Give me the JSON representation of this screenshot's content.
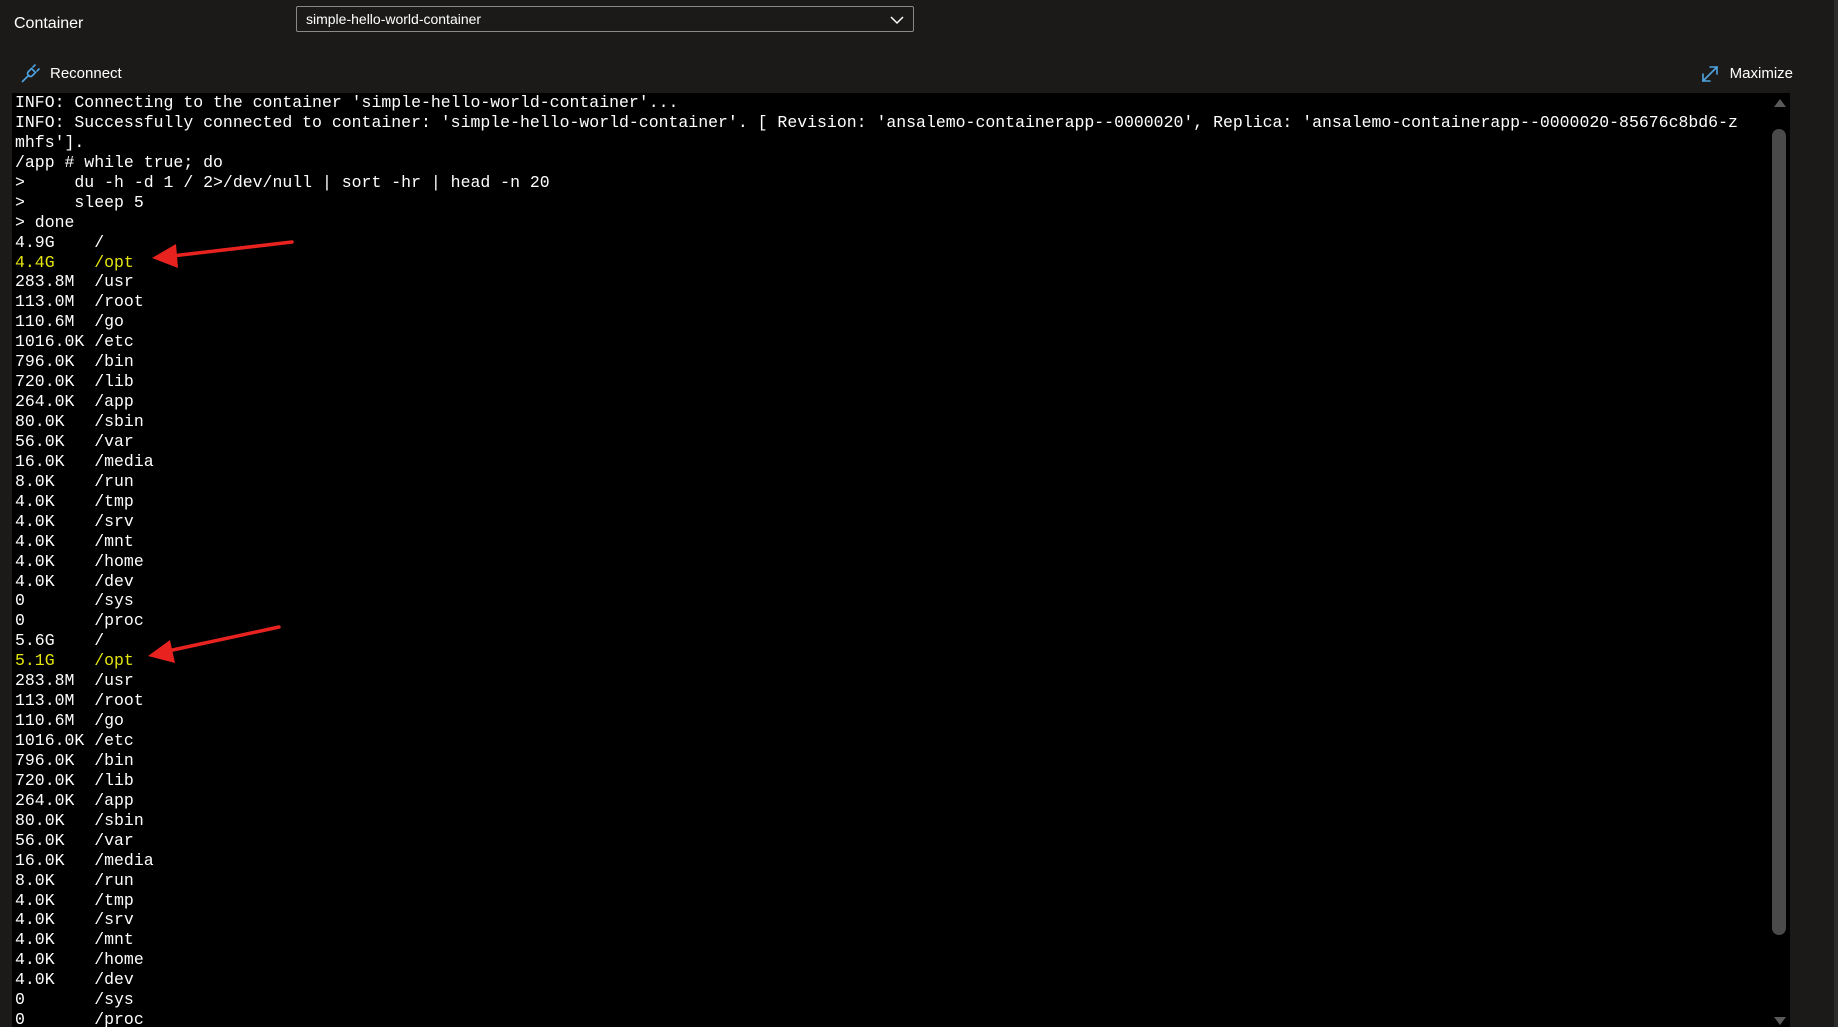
{
  "header": {
    "container_label": "Container",
    "container_select_value": "simple-hello-world-container"
  },
  "toolbar": {
    "reconnect_label": "Reconnect",
    "maximize_label": "Maximize"
  },
  "terminal": {
    "highlight_color": "#e5e510",
    "lines": [
      {
        "text": "INFO: Connecting to the container 'simple-hello-world-container'..."
      },
      {
        "text": "INFO: Successfully connected to container: 'simple-hello-world-container'. [ Revision: 'ansalemo-containerapp--0000020', Replica: 'ansalemo-containerapp--0000020-85676c8bd6-z"
      },
      {
        "text": "mhfs']."
      },
      {
        "text": "/app # while true; do"
      },
      {
        "text": ">     du -h -d 1 / 2>/dev/null | sort -hr | head -n 20"
      },
      {
        "text": ">     sleep 5"
      },
      {
        "text": "> done"
      },
      {
        "text": "4.9G    /"
      },
      {
        "text": "4.4G    /opt",
        "highlight": true
      },
      {
        "text": "283.8M  /usr"
      },
      {
        "text": "113.0M  /root"
      },
      {
        "text": "110.6M  /go"
      },
      {
        "text": "1016.0K /etc"
      },
      {
        "text": "796.0K  /bin"
      },
      {
        "text": "720.0K  /lib"
      },
      {
        "text": "264.0K  /app"
      },
      {
        "text": "80.0K   /sbin"
      },
      {
        "text": "56.0K   /var"
      },
      {
        "text": "16.0K   /media"
      },
      {
        "text": "8.0K    /run"
      },
      {
        "text": "4.0K    /tmp"
      },
      {
        "text": "4.0K    /srv"
      },
      {
        "text": "4.0K    /mnt"
      },
      {
        "text": "4.0K    /home"
      },
      {
        "text": "4.0K    /dev"
      },
      {
        "text": "0       /sys"
      },
      {
        "text": "0       /proc"
      },
      {
        "text": "5.6G    /"
      },
      {
        "text": "5.1G    /opt",
        "highlight": true
      },
      {
        "text": "283.8M  /usr"
      },
      {
        "text": "113.0M  /root"
      },
      {
        "text": "110.6M  /go"
      },
      {
        "text": "1016.0K /etc"
      },
      {
        "text": "796.0K  /bin"
      },
      {
        "text": "720.0K  /lib"
      },
      {
        "text": "264.0K  /app"
      },
      {
        "text": "80.0K   /sbin"
      },
      {
        "text": "56.0K   /var"
      },
      {
        "text": "16.0K   /media"
      },
      {
        "text": "8.0K    /run"
      },
      {
        "text": "4.0K    /tmp"
      },
      {
        "text": "4.0K    /srv"
      },
      {
        "text": "4.0K    /mnt"
      },
      {
        "text": "4.0K    /home"
      },
      {
        "text": "4.0K    /dev"
      },
      {
        "text": "0       /sys"
      },
      {
        "text": "0       /proc"
      }
    ]
  },
  "annotation": {
    "arrow_color": "#e8231f"
  }
}
